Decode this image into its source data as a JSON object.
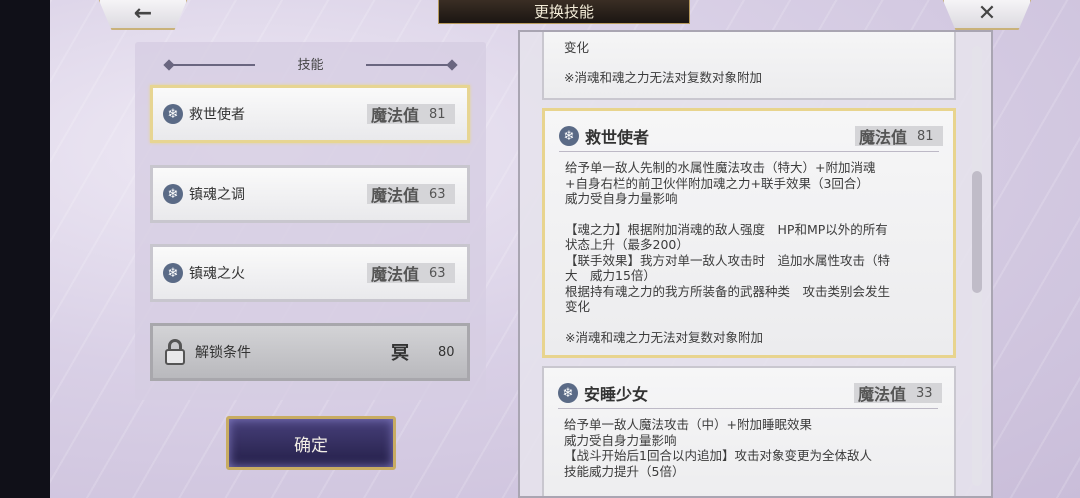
{
  "header": {
    "title": "更换技能",
    "back_icon": "arrow-left-icon",
    "close_icon": "close-icon"
  },
  "left_panel": {
    "heading": "技能",
    "skills": [
      {
        "name": "救世使者",
        "mp_label": "魔法值",
        "mp": "81",
        "icon": "snowflake-icon",
        "selected": true
      },
      {
        "name": "镇魂之调",
        "mp_label": "魔法值",
        "mp": "63",
        "icon": "snowflake-icon"
      },
      {
        "name": "镇魂之火",
        "mp_label": "魔法值",
        "mp": "63",
        "icon": "snowflake-icon"
      }
    ],
    "locked": {
      "name": "解锁条件",
      "glyph": "冥",
      "value": "80"
    }
  },
  "confirm_label": "确定",
  "details": {
    "prev_tail": "变化",
    "prev_note": "※消魂和魂之力无法对复数对象附加",
    "selected": {
      "title": "救世使者",
      "mp_label": "魔法值",
      "mp": "81",
      "para1": "给予单一敌人先制的水属性魔法攻击（特大）+附加消魂\n+自身右栏的前卫伙伴附加魂之力+联手效果（3回合）\n威力受自身力量影响",
      "para2": "【魂之力】根据附加消魂的敌人强度　HP和MP以外的所有\n状态上升（最多200）\n【联手效果】我方对单一敌人攻击时　追加水属性攻击（特\n大　威力15倍）\n根据持有魂之力的我方所装备的武器种类　攻击类别会发生\n变化",
      "note": "※消魂和魂之力无法对复数对象附加"
    },
    "next": {
      "title": "安睡少女",
      "mp_label": "魔法值",
      "mp": "33",
      "text": "给予单一敌人魔法攻击（中）+附加睡眠效果\n威力受自身力量影响\n【战斗开始后1回合以内追加】攻击对象变更为全体敌人\n技能威力提升（5倍）"
    }
  }
}
